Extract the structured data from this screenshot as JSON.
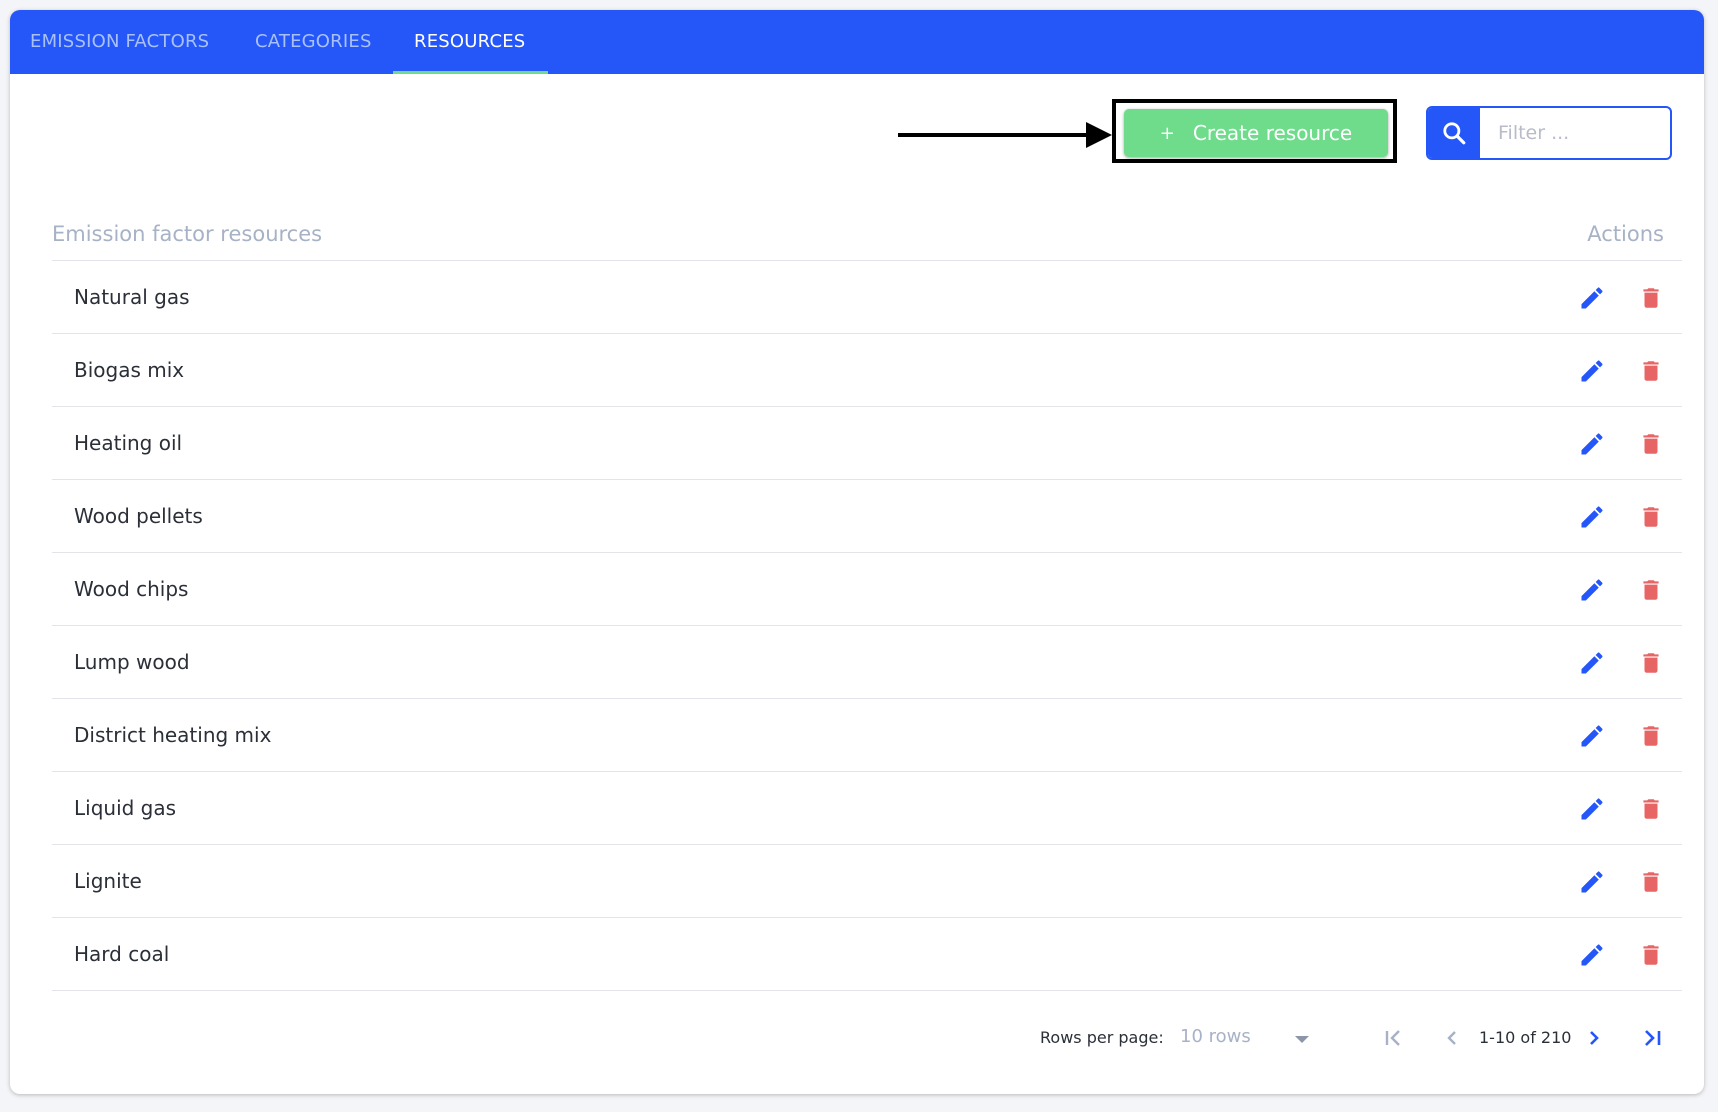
{
  "tabs": [
    {
      "label": "EMISSION FACTORS",
      "active": false
    },
    {
      "label": "CATEGORIES",
      "active": false
    },
    {
      "label": "RESOURCES",
      "active": true
    }
  ],
  "toolbar": {
    "create_plus": "+",
    "create_label": "Create resource",
    "filter_placeholder": "Filter ..."
  },
  "table": {
    "header_name": "Emission factor resources",
    "header_actions": "Actions",
    "rows": [
      "Natural gas",
      "Biogas mix",
      "Heating oil",
      "Wood pellets",
      "Wood chips",
      "Lump wood",
      "District heating mix",
      "Liquid gas",
      "Lignite",
      "Hard coal"
    ]
  },
  "pagination": {
    "rows_per_page_label": "Rows per page:",
    "rows_per_page_value": "10 rows",
    "range": "1-10 of 210"
  },
  "colors": {
    "primary": "#2456f8",
    "success": "#6fdc8c",
    "danger": "#e86565"
  }
}
